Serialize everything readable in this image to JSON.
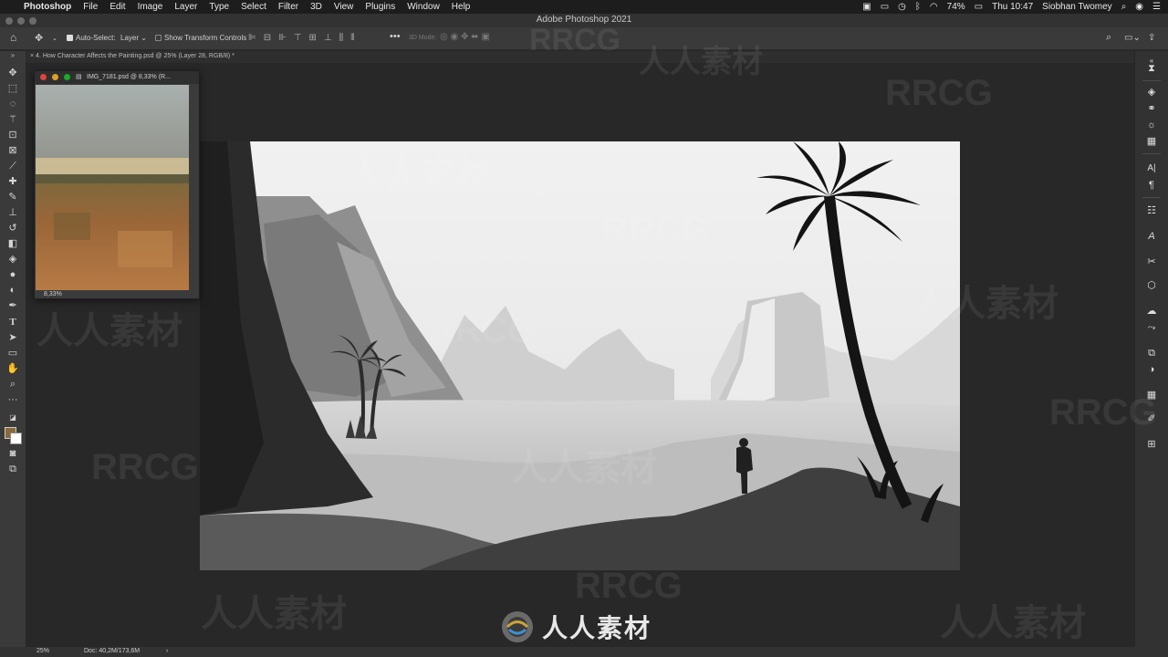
{
  "menubar": {
    "app_name": "Photoshop",
    "items": [
      "File",
      "Edit",
      "Image",
      "Layer",
      "Type",
      "Select",
      "Filter",
      "3D",
      "View",
      "Plugins",
      "Window",
      "Help"
    ],
    "battery": "74%",
    "clock": "Thu 10:47",
    "user": "Siobhan Twomey"
  },
  "window": {
    "title": "Adobe Photoshop 2021"
  },
  "options": {
    "auto_select_label": "Auto-Select:",
    "auto_select_target": "Layer",
    "show_transform_label": "Show Transform Controls",
    "mode_3d_label": "3D Mode:"
  },
  "document": {
    "tab_title": "4. How Character Affects the Painting.psd @ 25% (Layer 28, RGB/8) *",
    "zoom": "25%",
    "doc_size": "Doc: 40,2M/173,6M"
  },
  "navigator": {
    "title": "IMG_7181.psd @ 8,33% (R...",
    "zoom": "8,33%"
  },
  "watermark": {
    "brand": "RRCG",
    "cn_text": "人人素材"
  },
  "colors": {
    "menubar_bg": "#1d1d1d",
    "panel_bg": "#3a3a3a",
    "workspace_bg": "#282828",
    "foreground_swatch": "#8a6a3a",
    "background_swatch": "#ffffff"
  },
  "icons": {
    "left_tools": [
      "move-icon",
      "marquee-icon",
      "lasso-icon",
      "magic-wand-icon",
      "crop-icon",
      "frame-icon",
      "eyedropper-icon",
      "healing-icon",
      "brush-icon",
      "stamp-icon",
      "history-brush-icon",
      "eraser-icon",
      "bucket-icon",
      "blur-icon",
      "dodge-icon",
      "pen-icon",
      "type-icon",
      "path-select-icon",
      "rectangle-icon",
      "hand-icon",
      "zoom-icon",
      "more-icon"
    ],
    "right_panels": [
      "history-icon",
      "layers-icon",
      "channels-icon",
      "adjustments-icon",
      "swatches-icon",
      "character-icon",
      "paragraph-icon",
      "properties-icon",
      "glyphs-icon",
      "tools-icon",
      "3d-icon",
      "libraries-icon",
      "paths-icon",
      "navigator-icon",
      "color-icon",
      "grid-icon",
      "brush-settings-icon",
      "clone-source-icon"
    ]
  }
}
